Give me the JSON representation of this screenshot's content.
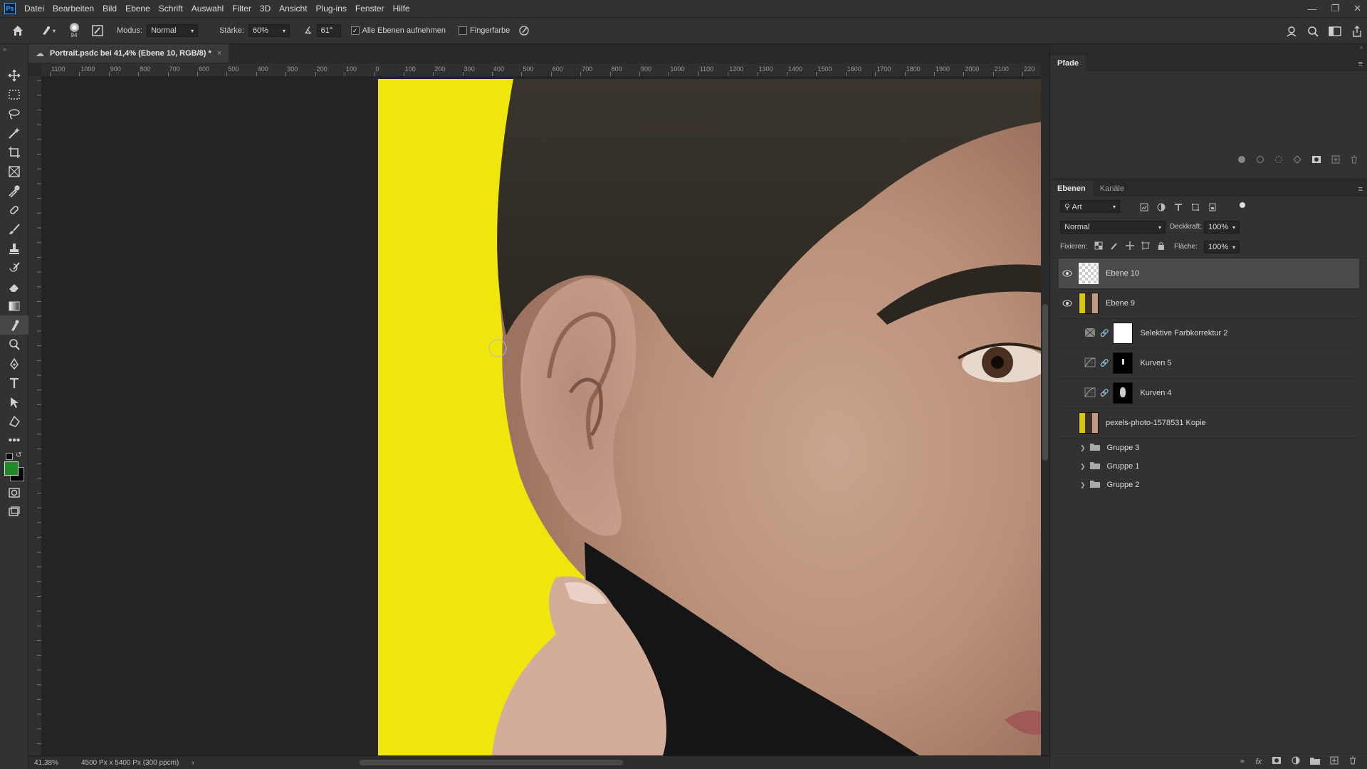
{
  "menu": {
    "logo": "Ps",
    "items": [
      "Datei",
      "Bearbeiten",
      "Bild",
      "Ebene",
      "Schrift",
      "Auswahl",
      "Filter",
      "3D",
      "Ansicht",
      "Plug-ins",
      "Fenster",
      "Hilfe"
    ]
  },
  "options": {
    "brush_size": "94",
    "mode_label": "Modus:",
    "mode_value": "Normal",
    "strength_label": "Stärke:",
    "strength_value": "60%",
    "angle_value": "61°",
    "sample_all_label": "Alle Ebenen aufnehmen",
    "sample_all_checked": true,
    "finger_paint_label": "Fingerfarbe",
    "finger_paint_checked": false
  },
  "document": {
    "tab_title": "Portrait.psdc bei 41,4% (Ebene 10, RGB/8) *",
    "close": "×"
  },
  "ruler": {
    "top_labels": [
      "1100",
      "1000",
      "900",
      "800",
      "700",
      "600",
      "500",
      "400",
      "300",
      "200",
      "100",
      "0",
      "100",
      "200",
      "300",
      "400",
      "500",
      "600",
      "700",
      "800",
      "900",
      "1000",
      "1100",
      "1200",
      "1300",
      "1400",
      "1500",
      "1600",
      "1700",
      "1800",
      "1900",
      "2000",
      "2100",
      "220"
    ]
  },
  "status": {
    "zoom": "41,38%",
    "dimensions": "4500 Px x 5400 Px (300 ppcm)",
    "arrow": "›"
  },
  "paths_panel": {
    "tab": "Pfade"
  },
  "layers_panel": {
    "tabs": [
      "Ebenen",
      "Kanäle"
    ],
    "filter_kind": "Art",
    "blend_mode": "Normal",
    "opacity_label": "Deckkraft:",
    "opacity_value": "100%",
    "lock_label": "Fixieren:",
    "fill_label": "Fläche:",
    "fill_value": "100%",
    "layers": [
      {
        "name": "Ebene 10",
        "visible": true,
        "selected": true,
        "type": "pixel-transparent"
      },
      {
        "name": "Ebene 9",
        "visible": true,
        "selected": false,
        "type": "photo"
      },
      {
        "name": "Selektive Farbkorrektur 2",
        "visible": false,
        "selected": false,
        "type": "adjustment-selective"
      },
      {
        "name": "Kurven 5",
        "visible": false,
        "selected": false,
        "type": "adjustment-curves"
      },
      {
        "name": "Kurven 4",
        "visible": false,
        "selected": false,
        "type": "adjustment-curves"
      },
      {
        "name": "pexels-photo-1578531 Kopie",
        "visible": false,
        "selected": false,
        "type": "photo"
      }
    ],
    "groups": [
      "Gruppe 3",
      "Gruppe 1",
      "Gruppe 2"
    ]
  },
  "colors": {
    "foreground": "#1e8a2a",
    "background": "#000000",
    "photo_background": "#efe60c"
  }
}
